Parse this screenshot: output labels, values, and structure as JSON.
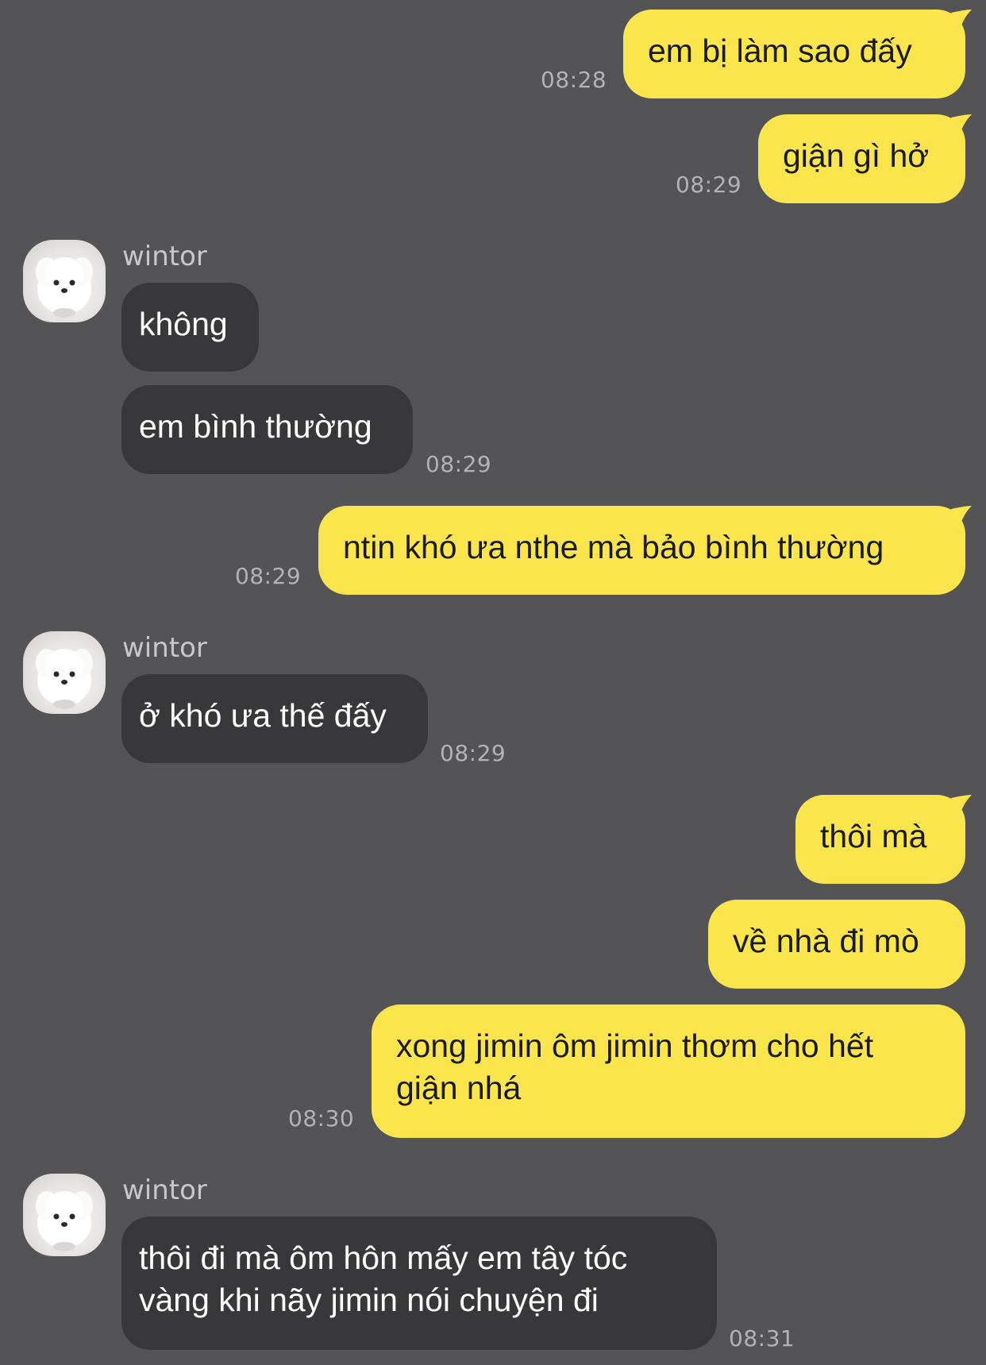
{
  "contact": {
    "name": "wintor",
    "avatar_icon": "white-puppy-avatar"
  },
  "colors": {
    "background": "#545355",
    "outgoing_bubble": "#FAE64C",
    "incoming_bubble": "#38373A",
    "timestamp": "#B3B2B4"
  },
  "messages": [
    {
      "from": "me",
      "text": "em bị làm sao đấy",
      "time": "08:28"
    },
    {
      "from": "me",
      "text": "giận gì hở",
      "time": "08:29"
    },
    {
      "from": "them",
      "text": "không"
    },
    {
      "from": "them",
      "text": "em bình thường",
      "time": "08:29"
    },
    {
      "from": "me",
      "text": "ntin khó ưa nthe mà bảo bình thường",
      "time": "08:29"
    },
    {
      "from": "them",
      "text": "ở khó ưa thế đấy",
      "time": "08:29"
    },
    {
      "from": "me",
      "text": "thôi mà"
    },
    {
      "from": "me",
      "text": "về nhà đi mò"
    },
    {
      "from": "me",
      "text": "xong jimin ôm jimin thơm cho hết giận nhá",
      "time": "08:30"
    },
    {
      "from": "them",
      "text": "thôi đi mà ôm hôn mấy em tây tóc vàng khi nãy jimin nói chuyện đi",
      "time": "08:31"
    }
  ]
}
